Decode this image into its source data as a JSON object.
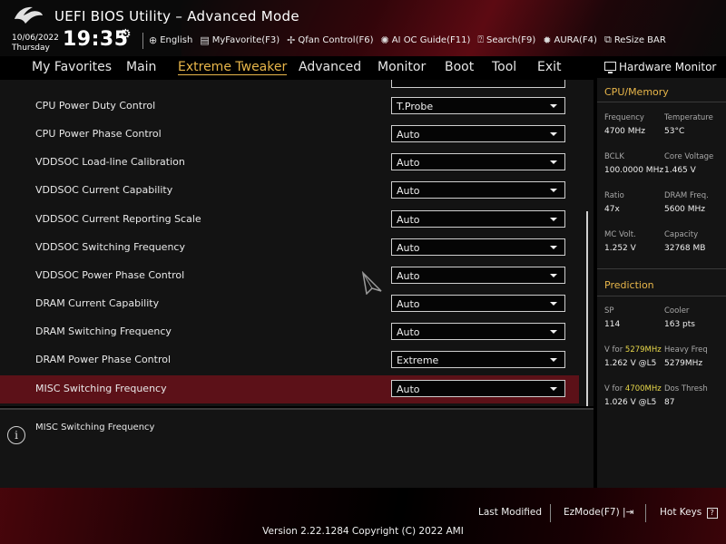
{
  "header": {
    "title": "UEFI BIOS Utility – Advanced Mode",
    "date": "10/06/2022",
    "day": "Thursday",
    "time": "19:35",
    "toolbar": [
      {
        "label": "English",
        "icon": "globe-icon"
      },
      {
        "label": "MyFavorite(F3)",
        "icon": "favorite-icon"
      },
      {
        "label": "Qfan Control(F6)",
        "icon": "fan-icon"
      },
      {
        "label": "AI OC Guide(F11)",
        "icon": "bulb-icon"
      },
      {
        "label": "Search(F9)",
        "icon": "question-icon"
      },
      {
        "label": "AURA(F4)",
        "icon": "aura-icon"
      },
      {
        "label": "ReSize BAR",
        "icon": "resize-bar-icon"
      }
    ]
  },
  "menu": {
    "items": [
      "My Favorites",
      "Main",
      "Extreme Tweaker",
      "Advanced",
      "Monitor",
      "Boot",
      "Tool",
      "Exit"
    ],
    "active": "Extreme Tweaker"
  },
  "settings": [
    {
      "label": "CPU Power Duty Control",
      "value": "T.Probe"
    },
    {
      "label": "CPU Power Phase Control",
      "value": "Auto"
    },
    {
      "label": "VDDSOC Load-line Calibration",
      "value": "Auto"
    },
    {
      "label": "VDDSOC Current Capability",
      "value": "Auto"
    },
    {
      "label": "VDDSOC Current Reporting Scale",
      "value": "Auto"
    },
    {
      "label": "VDDSOC Switching Frequency",
      "value": "Auto"
    },
    {
      "label": "VDDSOC Power Phase Control",
      "value": "Auto"
    },
    {
      "label": "DRAM Current Capability",
      "value": "Auto"
    },
    {
      "label": "DRAM Switching Frequency",
      "value": "Auto"
    },
    {
      "label": "DRAM Power Phase Control",
      "value": "Extreme"
    },
    {
      "label": "MISC Switching Frequency",
      "value": "Auto"
    }
  ],
  "selected_setting": "MISC Switching Frequency",
  "help": {
    "text": "MISC Switching Frequency"
  },
  "hardware_monitor": {
    "title": "Hardware Monitor",
    "cpu_memory": {
      "section": "CPU/Memory",
      "frequency_label": "Frequency",
      "frequency": "4700 MHz",
      "temperature_label": "Temperature",
      "temperature": "53°C",
      "bclk_label": "BCLK",
      "bclk": "100.0000 MHz",
      "core_voltage_label": "Core Voltage",
      "core_voltage": "1.465 V",
      "ratio_label": "Ratio",
      "ratio": "47x",
      "dram_freq_label": "DRAM Freq.",
      "dram_freq": "5600 MHz",
      "mc_volt_label": "MC Volt.",
      "mc_volt": "1.252 V",
      "capacity_label": "Capacity",
      "capacity": "32768 MB"
    },
    "prediction": {
      "section": "Prediction",
      "sp_label": "SP",
      "sp": "114",
      "cooler_label": "Cooler",
      "cooler": "163 pts",
      "v_for_label_1": "V for",
      "v_for_freq_1": "5279MHz",
      "v_for_value_1": "1.262 V @L5",
      "heavy_freq_label": "Heavy Freq",
      "heavy_freq": "5279MHz",
      "v_for_label_2": "V for",
      "v_for_freq_2": "4700MHz",
      "v_for_value_2": "1.026 V @L5",
      "dos_thresh_label": "Dos Thresh",
      "dos_thresh": "87"
    }
  },
  "footer": {
    "last_modified": "Last Modified",
    "ezmode": "EzMode(F7)",
    "hot_keys": "Hot Keys",
    "version": "Version 2.22.1284 Copyright (C) 2022 AMI"
  },
  "colors": {
    "accent": "#e8b64a",
    "selected_row": "#5c1118",
    "highlight_freq": "#e8d84a"
  }
}
